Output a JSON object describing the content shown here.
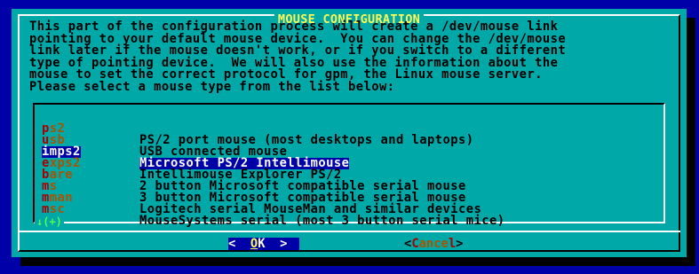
{
  "dialog": {
    "title": "MOUSE CONFIGURATION",
    "message_lines": [
      "This part of the configuration process will create a /dev/mouse link",
      "pointing to your default mouse device.  You can change the /dev/mouse",
      "link later if the mouse doesn't work, or if you switch to a different",
      "type of pointing device.  We will also use the information about the",
      "mouse to set the correct protocol for gpm, the Linux mouse server.",
      "Please select a mouse type from the list below:"
    ]
  },
  "list": {
    "items": [
      {
        "tag_hot": "p",
        "tag_rest": "s2",
        "desc": "PS/2 port mouse (most desktops and laptops)"
      },
      {
        "tag_hot": "u",
        "tag_rest": "sb",
        "desc": "USB connected mouse"
      },
      {
        "tag_hot": "i",
        "tag_rest": "mps2",
        "desc": "Microsoft PS/2 Intellimouse"
      },
      {
        "tag_hot": "e",
        "tag_rest": "xps2",
        "desc": "Intellimouse Explorer PS/2"
      },
      {
        "tag_hot": "b",
        "tag_rest": "are",
        "desc": "2 button Microsoft compatible serial mouse"
      },
      {
        "tag_hot": "m",
        "tag_rest": "s",
        "desc": "3 button Microsoft compatible serial mouse"
      },
      {
        "tag_hot": "m",
        "tag_rest": "man",
        "desc": "Logitech serial MouseMan and similar devices"
      },
      {
        "tag_hot": "m",
        "tag_rest": "sc",
        "desc": "MouseSystems serial (most 3 button serial mice)"
      }
    ],
    "selected_index": 2,
    "scroll_indicator": "↓(+)"
  },
  "buttons": {
    "ok": {
      "left": "<  ",
      "hot": "O",
      "rest": "K",
      "right": "  >"
    },
    "cancel": {
      "left": "<",
      "hot": "C",
      "rest": "ance",
      "hot2": "l",
      "right": ">"
    }
  },
  "colors": {
    "screen_bg": "#0000a8",
    "dialog_bg": "#00a8a8",
    "title": "#fcfc54",
    "hotkey": "#a80000",
    "selection_bg": "#0000a8",
    "scroll_indicator": "#54fc54"
  }
}
